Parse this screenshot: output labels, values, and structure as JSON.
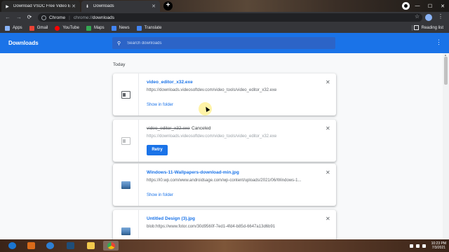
{
  "tabs": [
    {
      "label": "Download VSDC Free Video Edit",
      "icon": "vsdc-icon"
    },
    {
      "label": "Downloads",
      "icon": "download-icon"
    }
  ],
  "address_bar": {
    "site": "Chrome",
    "scheme": "chrome://",
    "path": "downloads"
  },
  "bookmarks": [
    {
      "label": "Apps",
      "icon": "apps-icon",
      "color": "#8ab4f8"
    },
    {
      "label": "Gmail",
      "icon": "gmail-icon",
      "color": "#ea4335"
    },
    {
      "label": "YouTube",
      "icon": "youtube-icon",
      "color": "#ff0000"
    },
    {
      "label": "Maps",
      "icon": "maps-icon",
      "color": "#34a853"
    },
    {
      "label": "News",
      "icon": "news-icon",
      "color": "#4285f4"
    },
    {
      "label": "Translate",
      "icon": "translate-icon",
      "color": "#4285f4"
    }
  ],
  "reading_list": "Reading list",
  "header": {
    "title": "Downloads",
    "search_placeholder": "Search downloads"
  },
  "section_label": "Today",
  "downloads": [
    {
      "filename": "video_editor_x32.exe",
      "url": "https://downloads.videosoftdev.com/video_tools/video_editor_x32.exe",
      "action": "Show in folder",
      "status": ""
    },
    {
      "filename": "video_editor_x32.exe",
      "url": "https://downloads.videosoftdev.com/video_tools/video_editor_x32.exe",
      "status": "Canceled",
      "button": "Retry"
    },
    {
      "filename": "Windows-11-Wallpapers-download-min.jpg",
      "url": "https://i0.wp.com/www.androidsage.com/wp-content/uploads/2021/06/Windows-1...",
      "action": "Show in folder"
    },
    {
      "filename": "Untitled Design (3).jpg",
      "url": "blob:https://www.fotor.com/30d9560f-7ed1-4fd4-b85d-6647a13d6b91"
    }
  ],
  "taskbar": {
    "items": [
      {
        "name": "start-icon",
        "color": "#1b75d0"
      },
      {
        "name": "media-icon",
        "color": "#d96b1a"
      },
      {
        "name": "ie-icon",
        "color": "#2d7fd3"
      },
      {
        "name": "vsdc-taskbar-icon",
        "color": "#1f4e79"
      },
      {
        "name": "explorer-icon",
        "color": "#f2c94c"
      },
      {
        "name": "chrome-taskbar-icon",
        "color": "#34a853"
      }
    ],
    "time": "10:23 PM",
    "date": "7/3/2021"
  },
  "colors": {
    "accent": "#1a73e8",
    "header_bg": "#1a73e8",
    "chrome_dark": "#35363a"
  }
}
